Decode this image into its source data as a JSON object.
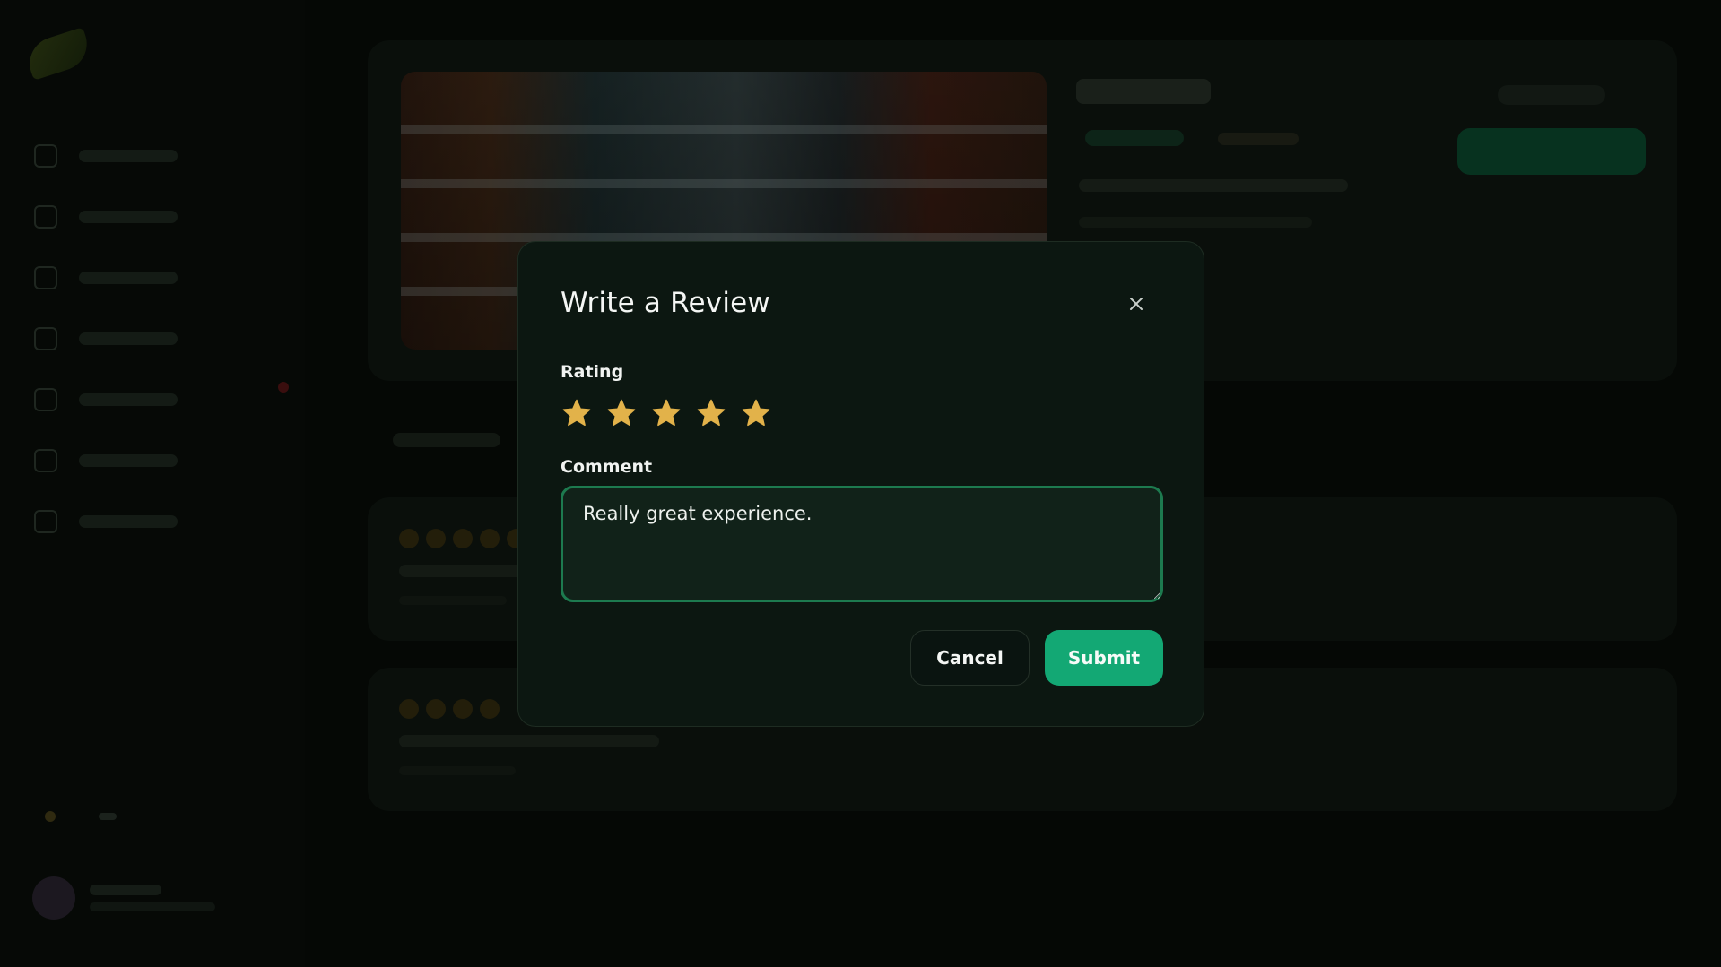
{
  "modal": {
    "title": "Write a Review",
    "rating_label": "Rating",
    "rating_value": 5,
    "rating_max": 5,
    "comment_label": "Comment",
    "comment_value": "Really great experience.",
    "cancel_label": "Cancel",
    "submit_label": "Submit"
  },
  "colors": {
    "accent": "#13a874",
    "star": "#e2b24a",
    "modal_bg": "#0c1711",
    "focus_border": "#1d7a4f"
  },
  "icons": {
    "close": "close-icon",
    "star": "star-icon"
  }
}
